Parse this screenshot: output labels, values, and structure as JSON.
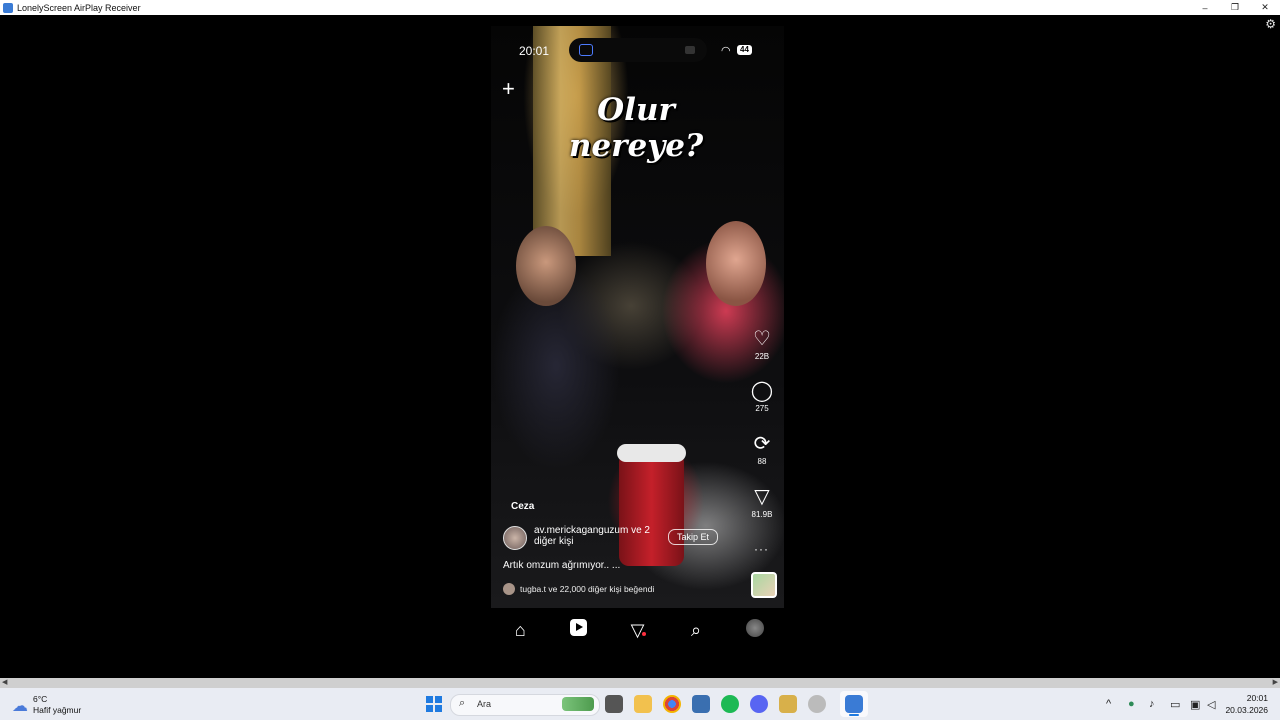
{
  "window": {
    "title": "LonelyScreen AirPlay Receiver",
    "minimize_glyph": "–",
    "restore_glyph": "❐",
    "close_glyph": "✕",
    "settings_icon": "gear-icon"
  },
  "phone": {
    "status_time": "20:01",
    "battery": "44",
    "headline": "Olur nereye?",
    "create_glyph": "+",
    "actions": {
      "likes": "22B",
      "comments": "275",
      "reposts": "88",
      "shares": "81.9B"
    },
    "song": "Ceza",
    "username_line": "av.merickaganguzum ve 2 diğer kişi",
    "follow_label": "Takip Et",
    "caption": "Artık omzum ağrımıyor.. ...",
    "liked_by": "tugba.t ve 22,000 diğer kişi beğendi",
    "more_glyph": "···"
  },
  "taskbar": {
    "weather_temp": "6°C",
    "weather_desc": "Hafif yağmur",
    "search_placeholder": "Ara",
    "clock_time": "20:01",
    "clock_date": "20.03.2026"
  },
  "colors": {
    "accent": "#1f7ae0",
    "notification_dot": "#ff3040"
  }
}
